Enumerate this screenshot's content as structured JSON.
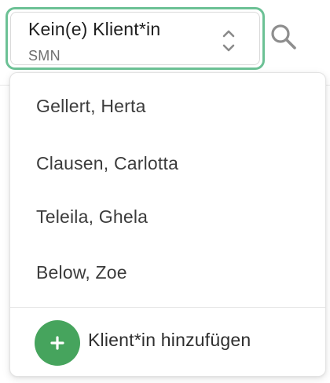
{
  "select": {
    "title": "Kein(e) Klient*in",
    "subtitle": "SMN",
    "sort_icon": "chevron-up-down-icon",
    "border_color": "#6cc195"
  },
  "search": {
    "icon": "search-icon"
  },
  "dropdown": {
    "options": [
      {
        "label": "Gellert, Herta"
      },
      {
        "label": "Clausen, Carlotta"
      },
      {
        "label": "Teleila, Ghela"
      },
      {
        "label": "Below, Zoe"
      }
    ],
    "add_button": {
      "label": "Klient*in hinzufügen",
      "icon": "plus-icon",
      "color": "#46a45d"
    }
  }
}
